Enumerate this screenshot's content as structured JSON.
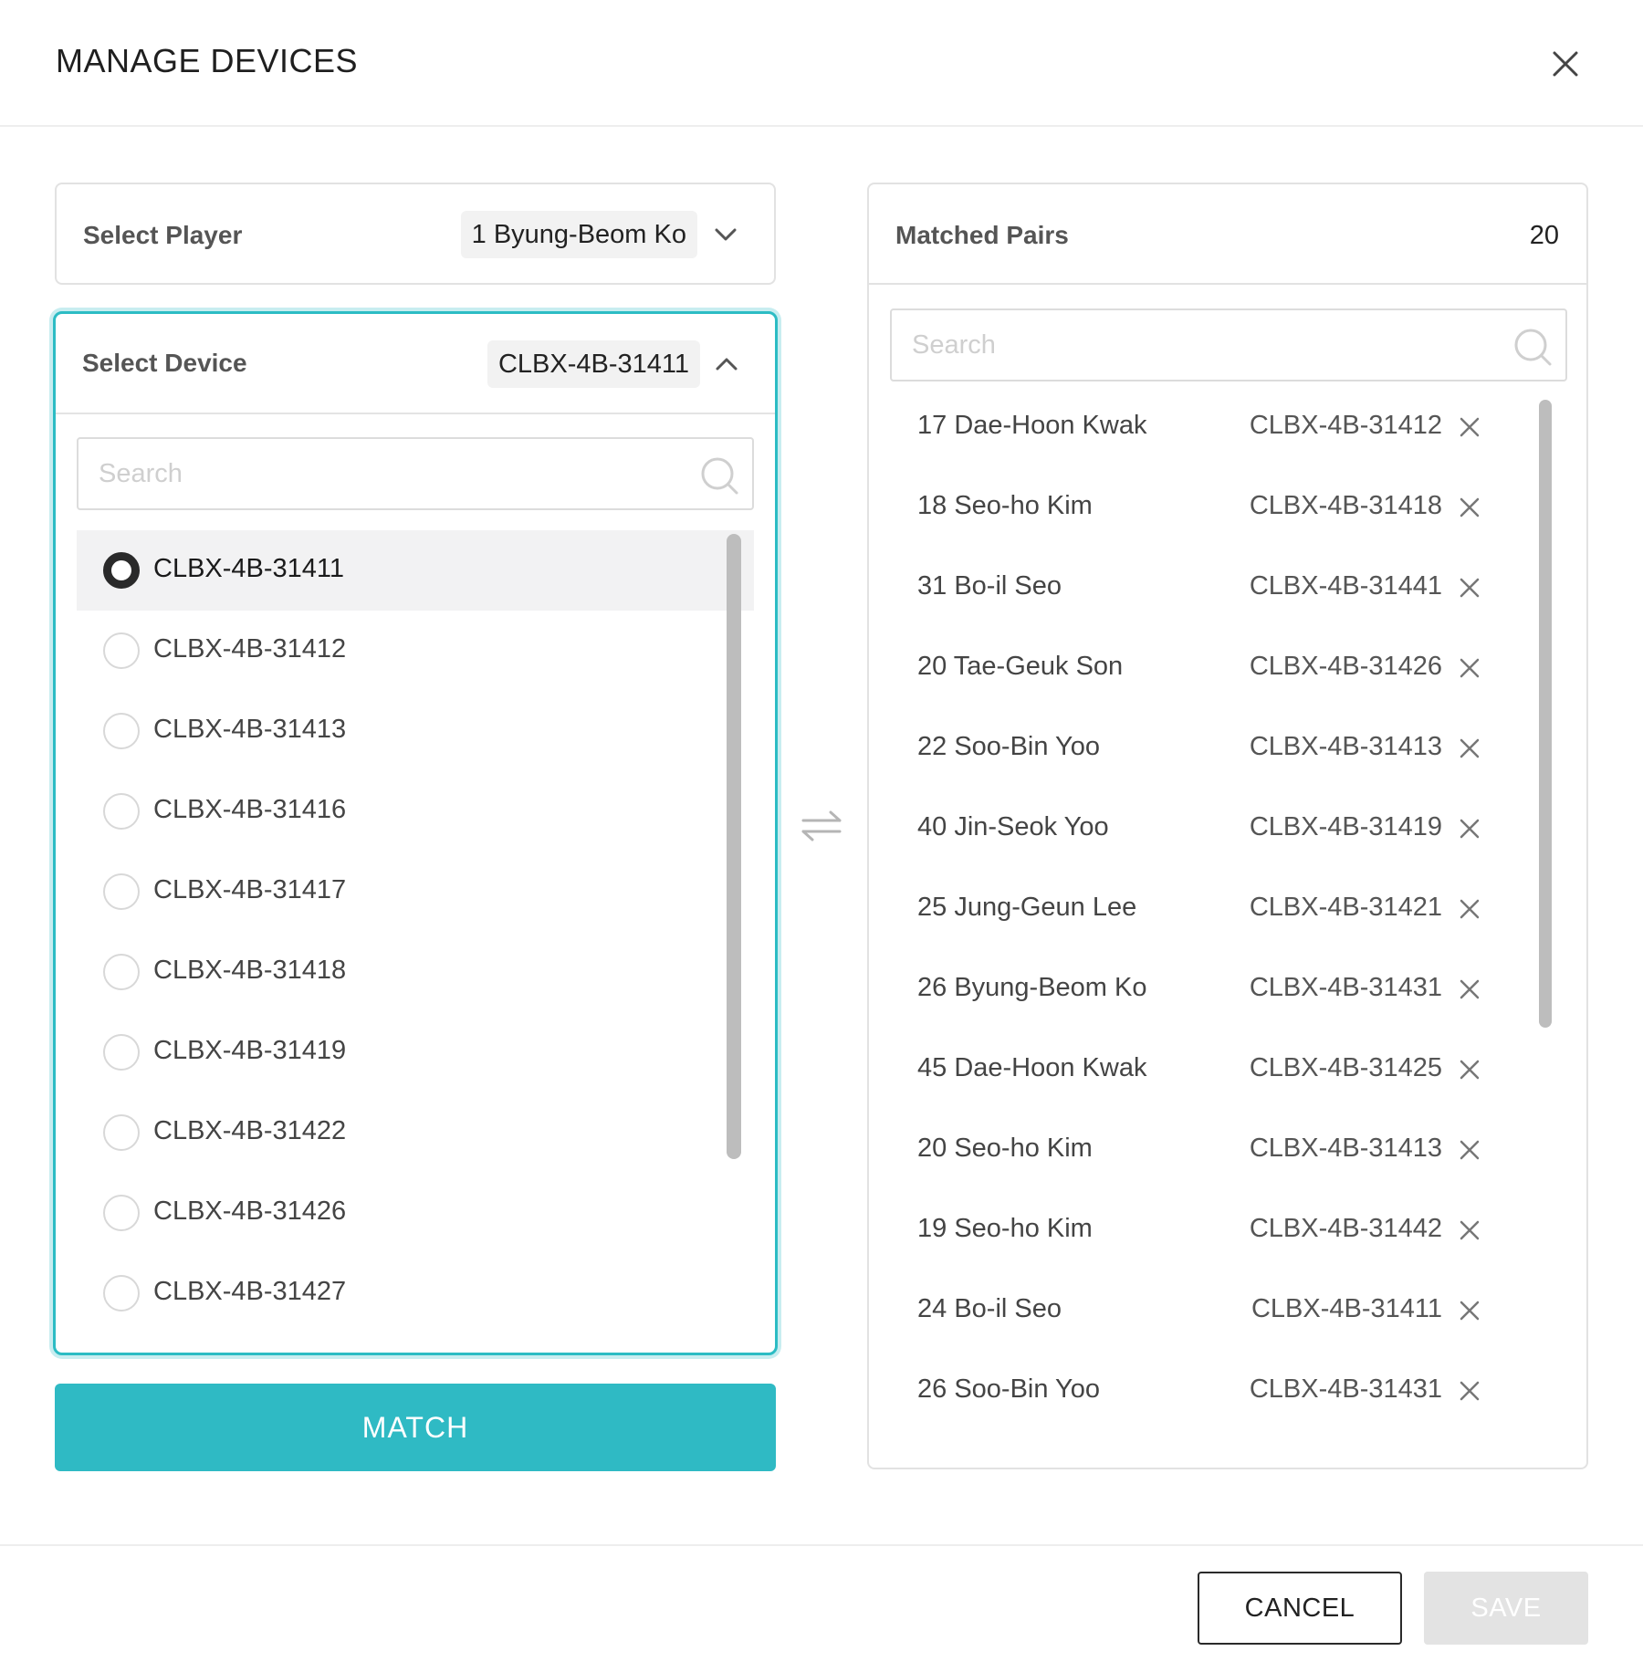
{
  "dialog": {
    "title": "MANAGE DEVICES",
    "close_icon": "close-icon"
  },
  "colors": {
    "accent": "#2fbac4",
    "focus_border": "#2cbcc4",
    "disabled": "#e3e3e3"
  },
  "player_select": {
    "label": "Select Player",
    "value": "1 Byung-Beom Ko",
    "icon": "chevron-down-icon"
  },
  "device_select": {
    "label": "Select Device",
    "value": "CLBX-4B-31411",
    "icon": "chevron-up-icon",
    "search_placeholder": "Search",
    "options": [
      {
        "label": "CLBX-4B-31411",
        "selected": true
      },
      {
        "label": "CLBX-4B-31412",
        "selected": false
      },
      {
        "label": "CLBX-4B-31413",
        "selected": false
      },
      {
        "label": "CLBX-4B-31416",
        "selected": false
      },
      {
        "label": "CLBX-4B-31417",
        "selected": false
      },
      {
        "label": "CLBX-4B-31418",
        "selected": false
      },
      {
        "label": "CLBX-4B-31419",
        "selected": false
      },
      {
        "label": "CLBX-4B-31422",
        "selected": false
      },
      {
        "label": "CLBX-4B-31426",
        "selected": false
      },
      {
        "label": "CLBX-4B-31427",
        "selected": false
      }
    ]
  },
  "match_button": {
    "label": "MATCH"
  },
  "swap_icon": "swap-arrows-icon",
  "matched_pairs": {
    "label": "Matched Pairs",
    "count": "20",
    "search_placeholder": "Search",
    "rows": [
      {
        "player": "17 Dae-Hoon Kwak",
        "device": "CLBX-4B-31412"
      },
      {
        "player": "18 Seo-ho Kim",
        "device": "CLBX-4B-31418"
      },
      {
        "player": "31 Bo-il Seo",
        "device": "CLBX-4B-31441"
      },
      {
        "player": "20 Tae-Geuk Son",
        "device": "CLBX-4B-31426"
      },
      {
        "player": "22 Soo-Bin Yoo",
        "device": "CLBX-4B-31413"
      },
      {
        "player": "40 Jin-Seok Yoo",
        "device": "CLBX-4B-31419"
      },
      {
        "player": "25 Jung-Geun Lee",
        "device": "CLBX-4B-31421"
      },
      {
        "player": "26 Byung-Beom Ko",
        "device": "CLBX-4B-31431"
      },
      {
        "player": "45 Dae-Hoon Kwak",
        "device": "CLBX-4B-31425"
      },
      {
        "player": "20 Seo-ho Kim",
        "device": "CLBX-4B-31413"
      },
      {
        "player": "19 Seo-ho Kim",
        "device": "CLBX-4B-31442"
      },
      {
        "player": "24 Bo-il Seo",
        "device": "CLBX-4B-31411"
      },
      {
        "player": "26 Soo-Bin Yoo",
        "device": "CLBX-4B-31431"
      }
    ]
  },
  "footer": {
    "cancel_label": "CANCEL",
    "save_label": "SAVE"
  }
}
